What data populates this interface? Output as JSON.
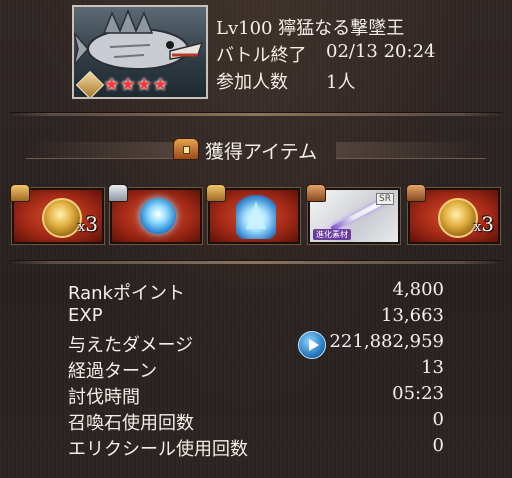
{
  "header": {
    "boss_name": "Lv100 獰猛なる撃墜王",
    "battle_end_label": "バトル終了",
    "battle_end_time": "02/13 20:24",
    "participants_label": "参加人数",
    "participants_value": "1人",
    "stars": "★★★★",
    "star_color": "#ff3a3a"
  },
  "items_section": {
    "title": "獲得アイテム",
    "items": [
      {
        "icon": "gold-medallion-icon",
        "quantity_prefix": "x",
        "quantity": "3",
        "chest": "gold"
      },
      {
        "icon": "blue-orb-icon",
        "quantity": "",
        "chest": "silver"
      },
      {
        "icon": "ice-crystal-icon",
        "quantity": "",
        "chest": "gold"
      },
      {
        "icon": "sword-icon",
        "badge": "SR",
        "material_label": "進化素材",
        "quantity": "",
        "chest": "bronze"
      },
      {
        "icon": "gold-medallion-icon",
        "quantity_prefix": "x",
        "quantity": "3",
        "chest": "bronze"
      }
    ]
  },
  "stats": [
    {
      "label": "Rankポイント",
      "value": "4,800"
    },
    {
      "label": "EXP",
      "value": "13,663"
    },
    {
      "label": "与えたダメージ",
      "value": "221,882,959"
    },
    {
      "label": "経過ターン",
      "value": "13"
    },
    {
      "label": "討伐時間",
      "value": "05:23"
    },
    {
      "label": "召喚石使用回数",
      "value": "0"
    },
    {
      "label": "エリクシール使用回数",
      "value": "0"
    }
  ],
  "colors": {
    "background": "#2a2321",
    "item_red": "#a52a17",
    "accent_blue": "#2a7cc4"
  }
}
